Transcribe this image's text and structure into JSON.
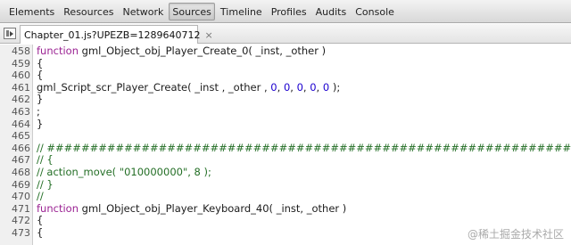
{
  "toolbar": {
    "tabs": [
      "Elements",
      "Resources",
      "Network",
      "Sources",
      "Timeline",
      "Profiles",
      "Audits",
      "Console"
    ],
    "active": "Sources"
  },
  "file_tab": {
    "label": "Chapter_01.js?UPEZB=1289640712",
    "close_glyph": "×"
  },
  "code": {
    "lines": [
      {
        "n": "458",
        "parts": [
          [
            "kw",
            "function"
          ],
          [
            "txt",
            " gml_Object_obj_Player_Create_0( _inst, _other )"
          ]
        ]
      },
      {
        "n": "459",
        "parts": [
          [
            "txt",
            "{"
          ]
        ]
      },
      {
        "n": "460",
        "parts": [
          [
            "txt",
            "{"
          ]
        ]
      },
      {
        "n": "461",
        "parts": [
          [
            "txt",
            "gml_Script_scr_Player_Create( _inst , _other , "
          ],
          [
            "num",
            "0"
          ],
          [
            "txt",
            ", "
          ],
          [
            "num",
            "0"
          ],
          [
            "txt",
            ", "
          ],
          [
            "num",
            "0"
          ],
          [
            "txt",
            ", "
          ],
          [
            "num",
            "0"
          ],
          [
            "txt",
            ", "
          ],
          [
            "num",
            "0"
          ],
          [
            "txt",
            " );"
          ]
        ]
      },
      {
        "n": "462",
        "parts": [
          [
            "txt",
            "}"
          ]
        ]
      },
      {
        "n": "463",
        "parts": [
          [
            "txt",
            ";"
          ]
        ]
      },
      {
        "n": "464",
        "parts": [
          [
            "txt",
            "}"
          ]
        ]
      },
      {
        "n": "465",
        "parts": []
      },
      {
        "n": "466",
        "parts": [
          [
            "cmt",
            "// ###################################################################################"
          ]
        ]
      },
      {
        "n": "467",
        "parts": [
          [
            "cmt",
            "// {"
          ]
        ]
      },
      {
        "n": "468",
        "parts": [
          [
            "cmt",
            "// action_move( \"010000000\", 8 );"
          ]
        ]
      },
      {
        "n": "469",
        "parts": [
          [
            "cmt",
            "// }"
          ]
        ]
      },
      {
        "n": "470",
        "parts": [
          [
            "cmt",
            "//"
          ]
        ]
      },
      {
        "n": "471",
        "parts": [
          [
            "kw",
            "function"
          ],
          [
            "txt",
            " gml_Object_obj_Player_Keyboard_40( _inst, _other )"
          ]
        ]
      },
      {
        "n": "472",
        "parts": [
          [
            "txt",
            "{"
          ]
        ]
      },
      {
        "n": "473",
        "parts": [
          [
            "txt",
            "{"
          ]
        ]
      }
    ]
  },
  "watermark": "@稀土掘金技术社区",
  "colors": {
    "keyword": "#9b2393",
    "number": "#1c00cf",
    "comment": "#236e25"
  }
}
